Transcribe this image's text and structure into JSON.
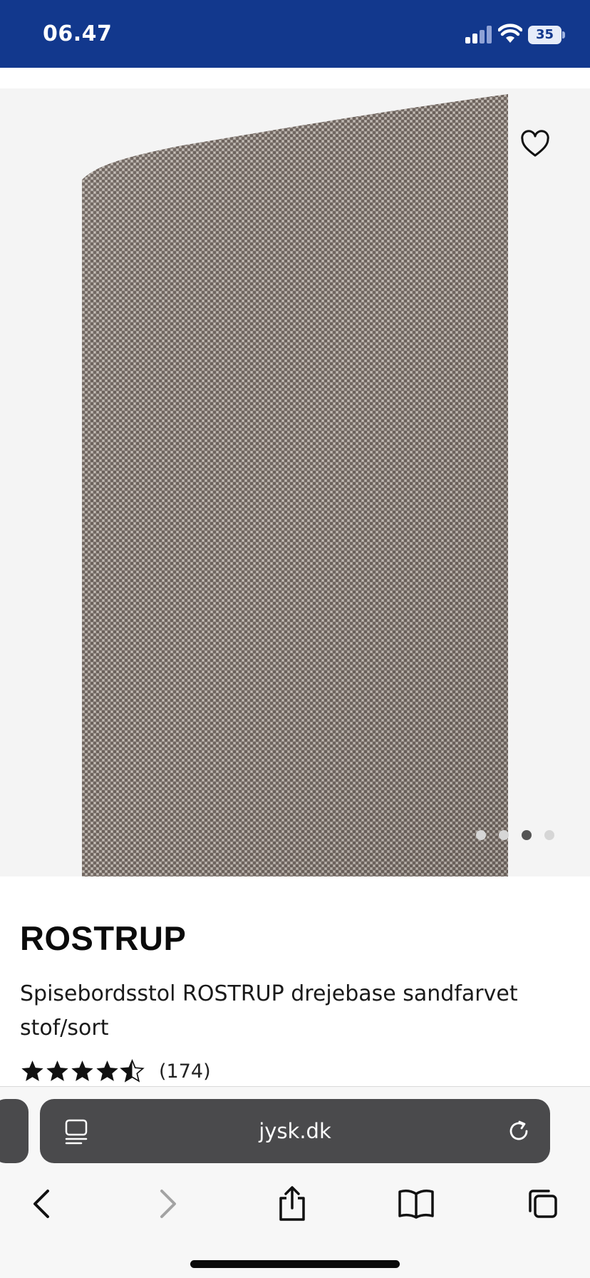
{
  "status_bar": {
    "time": "06.47",
    "battery_level": "35",
    "background_color": "#12388d",
    "icons": [
      "cellular-signal-icon",
      "wifi-icon",
      "battery-icon"
    ]
  },
  "gallery": {
    "favorite_icon": "heart-outline-icon",
    "image_count": 4,
    "active_image_index": 2
  },
  "product": {
    "name": "ROSTRUP",
    "description": "Spisebordsstol ROSTRUP drejebase sandfarvet stof/sort",
    "rating_value": 4.5,
    "rating_max": 5,
    "review_count": "(174)"
  },
  "browser": {
    "url": "jysk.dk",
    "icons": {
      "reader": "reader-mode-icon",
      "reload": "reload-icon",
      "back": "chevron-left-icon",
      "forward": "chevron-right-icon",
      "share": "share-icon",
      "bookmarks": "book-icon",
      "tabs": "tabs-icon"
    }
  }
}
